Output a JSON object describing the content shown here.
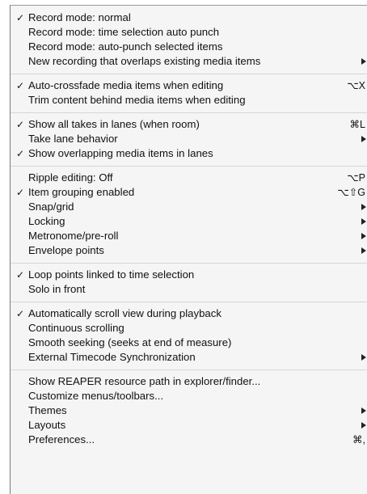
{
  "menu": {
    "groups": [
      {
        "items": [
          {
            "label": "Record mode: normal",
            "checked": true,
            "shortcut": "",
            "submenu": false
          },
          {
            "label": "Record mode: time selection auto punch",
            "checked": false,
            "shortcut": "",
            "submenu": false
          },
          {
            "label": "Record mode: auto-punch selected items",
            "checked": false,
            "shortcut": "",
            "submenu": false
          },
          {
            "label": "New recording that overlaps existing media items",
            "checked": false,
            "shortcut": "",
            "submenu": true
          }
        ]
      },
      {
        "items": [
          {
            "label": "Auto-crossfade media items when editing",
            "checked": true,
            "shortcut": "⌥X",
            "submenu": false
          },
          {
            "label": "Trim content behind media items when editing",
            "checked": false,
            "shortcut": "",
            "submenu": false
          }
        ]
      },
      {
        "items": [
          {
            "label": "Show all takes in lanes (when room)",
            "checked": true,
            "shortcut": "⌘L",
            "submenu": false
          },
          {
            "label": "Take lane behavior",
            "checked": false,
            "shortcut": "",
            "submenu": true
          },
          {
            "label": "Show overlapping media items in lanes",
            "checked": true,
            "shortcut": "",
            "submenu": false
          }
        ]
      },
      {
        "items": [
          {
            "label": "Ripple editing: Off",
            "checked": false,
            "shortcut": "⌥P",
            "submenu": false
          },
          {
            "label": "Item grouping enabled",
            "checked": true,
            "shortcut": "⌥⇧G",
            "submenu": false
          },
          {
            "label": "Snap/grid",
            "checked": false,
            "shortcut": "",
            "submenu": true
          },
          {
            "label": "Locking",
            "checked": false,
            "shortcut": "",
            "submenu": true
          },
          {
            "label": "Metronome/pre-roll",
            "checked": false,
            "shortcut": "",
            "submenu": true
          },
          {
            "label": "Envelope points",
            "checked": false,
            "shortcut": "",
            "submenu": true
          }
        ]
      },
      {
        "items": [
          {
            "label": "Loop points linked to time selection",
            "checked": true,
            "shortcut": "",
            "submenu": false
          },
          {
            "label": "Solo in front",
            "checked": false,
            "shortcut": "",
            "submenu": false
          }
        ]
      },
      {
        "items": [
          {
            "label": "Automatically scroll view during playback",
            "checked": true,
            "shortcut": "",
            "submenu": false
          },
          {
            "label": "Continuous scrolling",
            "checked": false,
            "shortcut": "",
            "submenu": false
          },
          {
            "label": "Smooth seeking (seeks at end of measure)",
            "checked": false,
            "shortcut": "",
            "submenu": false
          },
          {
            "label": "External Timecode Synchronization",
            "checked": false,
            "shortcut": "",
            "submenu": true
          }
        ]
      },
      {
        "items": [
          {
            "label": "Show REAPER resource path in explorer/finder...",
            "checked": false,
            "shortcut": "",
            "submenu": false
          },
          {
            "label": "Customize menus/toolbars...",
            "checked": false,
            "shortcut": "",
            "submenu": false
          },
          {
            "label": "Themes",
            "checked": false,
            "shortcut": "",
            "submenu": true
          },
          {
            "label": "Layouts",
            "checked": false,
            "shortcut": "",
            "submenu": true
          },
          {
            "label": "Preferences...",
            "checked": false,
            "shortcut": "⌘,",
            "submenu": false
          }
        ]
      }
    ]
  }
}
